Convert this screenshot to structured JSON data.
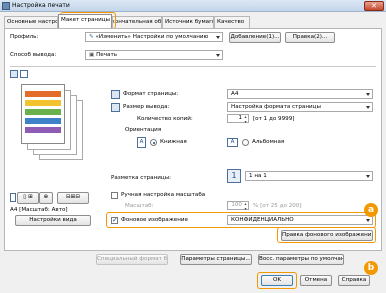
{
  "window": {
    "title": "Настройка печати",
    "close_label": "✕"
  },
  "tabs": [
    {
      "label": "Основные настройки"
    },
    {
      "label": "Макет страницы"
    },
    {
      "label": "Окончательная обработка"
    },
    {
      "label": "Источник бумаги"
    },
    {
      "label": "Качество"
    }
  ],
  "profile": {
    "label": "Профиль:",
    "value": "«Изменить» Настройки по умолчанию",
    "add_button": "Добавление(1)...",
    "edit_button": "Правка(2)..."
  },
  "output": {
    "label": "Способ вывода:",
    "value": "Печать"
  },
  "page_size": {
    "label": "Формат страницы:",
    "value": "A4"
  },
  "output_size": {
    "label": "Размер вывода:",
    "value": "Настройка формата страницы"
  },
  "copies": {
    "label": "Количество копий:",
    "value": "1",
    "range": "[от 1 до 9999]"
  },
  "orientation": {
    "label": "Ориентация",
    "portrait": "Книжная",
    "landscape": "Альбомная",
    "icon_letter": "A"
  },
  "page_layout": {
    "label": "Разметка страницы:",
    "value": "1 на 1",
    "icon_number": "1"
  },
  "manual_scaling": {
    "label": "Ручная настройка масштаба",
    "scale_label": "Масштаб:",
    "scale_value": "100",
    "scale_range": "% [от 25 до 200]"
  },
  "preview": {
    "caption": "A4 [Масштаб: Авто]"
  },
  "view_settings_button": "Настройки вида",
  "watermark": {
    "label": "Фоновое изображение",
    "value": "КОНФИДЕНЦИАЛЬНО",
    "edit_button": "Правка фонового изображения..."
  },
  "bottom_buttons": {
    "special_format": "Специальный формат бумаги...",
    "page_options": "Параметры страницы...",
    "restore_defaults": "Восс. параметры по умолчан"
  },
  "footer": {
    "ok": "OK",
    "cancel": "Отмена",
    "help": "Справка"
  },
  "badges": {
    "a": "a",
    "b": "b"
  },
  "colors": {
    "accent_orange": "#f39800",
    "preview_bar_1": "#e46c2a",
    "preview_bar_2": "#f2c230",
    "preview_bar_3": "#6ab04c",
    "preview_bar_4": "#3d82c9",
    "preview_bar_5": "#8e5bb5"
  }
}
